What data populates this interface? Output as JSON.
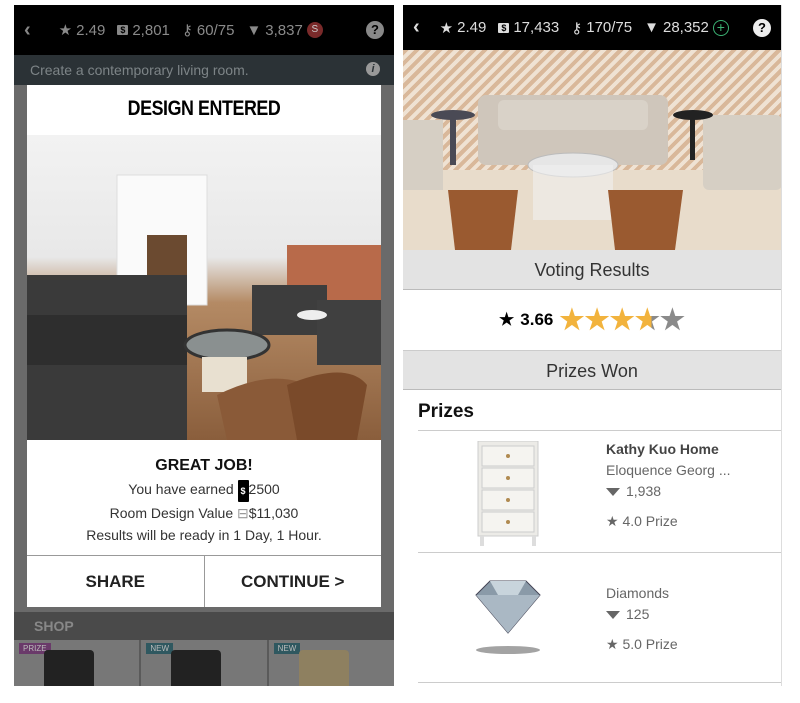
{
  "left": {
    "topbar": {
      "rating": "2.49",
      "cash": "2,801",
      "keys": "60/75",
      "diamonds": "3,837",
      "cash_icon_label": "$",
      "buy_icon_label": "S",
      "help": "?"
    },
    "brief": "Create a contemporary living room.",
    "modal": {
      "title": "DESIGN ENTERED",
      "great_job": "GREAT JOB!",
      "earned_prefix": "You have earned",
      "earned_amount": "2500",
      "value_prefix": "Room Design Value",
      "value_amount": "$11,030",
      "results": "Results will be ready in 1 Day, 1 Hour.",
      "share": "SHARE",
      "continue": "CONTINUE >"
    },
    "shop": {
      "label": "SHOP",
      "items": [
        {
          "badge": "PRIZE",
          "badge_color": "#8b3a8b"
        },
        {
          "badge": "NEW",
          "badge_color": "#2c6a78"
        },
        {
          "badge": "NEW",
          "badge_color": "#2c6a78"
        }
      ]
    }
  },
  "right": {
    "topbar": {
      "rating": "2.49",
      "cash": "17,433",
      "keys": "170/75",
      "diamonds": "28,352",
      "help": "?"
    },
    "voting_header": "Voting Results",
    "score": "3.66",
    "score_value": 3.66,
    "score_max": 5,
    "prizes_won_header": "Prizes Won",
    "prizes_title": "Prizes",
    "prizes": [
      {
        "brand": "Kathy Kuo Home",
        "name": "Eloquence Georg ...",
        "diamonds": "1,938",
        "prize": "4.0 Prize"
      },
      {
        "brand": "",
        "name": "Diamonds",
        "diamonds": "125",
        "prize": "5.0 Prize"
      }
    ]
  },
  "colors": {
    "star_gold": "#f2b33d",
    "star_gray": "#8a8a8a",
    "plus_green": "#3bb273",
    "buy_red": "#b03a3a"
  }
}
